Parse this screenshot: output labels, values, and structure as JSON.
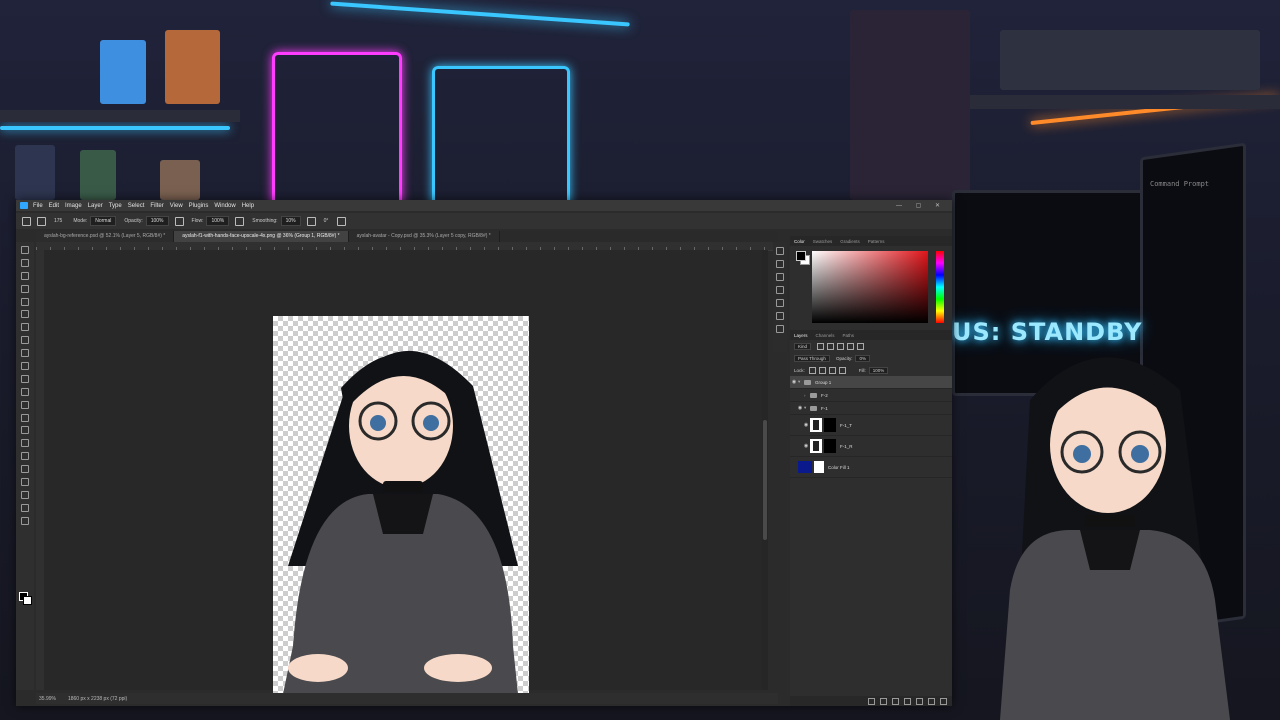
{
  "background": {
    "status_text": "US: STANDBY",
    "terminal_title": "Command Prompt"
  },
  "app": {
    "menu": [
      "File",
      "Edit",
      "Image",
      "Layer",
      "Type",
      "Select",
      "Filter",
      "View",
      "Plugins",
      "Window",
      "Help"
    ],
    "options": {
      "mode_label": "Mode:",
      "mode_value": "Normal",
      "opacity_label": "Opacity:",
      "opacity_value": "100%",
      "flow_label": "Flow:",
      "flow_value": "100%",
      "smoothing_label": "Smoothing:",
      "smoothing_value": "10%",
      "angle_value": "0°",
      "brush_size": "175"
    },
    "tabs": [
      {
        "label": "ayslah-bg-reference.psd @ 52.1% (Layer 5, RGB/8#) *",
        "active": false
      },
      {
        "label": "ayslah-f1-with-hands-face-upscale-4x.png @ 36% (Group 1, RGB/8#) *",
        "active": true
      },
      {
        "label": "ayslah-avatar - Copy.psd @ 35.3% (Layer 5 copy, RGB/8#) *",
        "active": false
      }
    ],
    "status": {
      "zoom": "35.99%",
      "doc_info": "1860 px x 2238 px (72 ppi)"
    }
  },
  "panels": {
    "color_tabs": [
      "Color",
      "Swatches",
      "Gradients",
      "Patterns"
    ],
    "layers_tabs": [
      "Layers",
      "Channels",
      "Paths"
    ],
    "kind": "Kind",
    "blend_mode": "Pass Through",
    "opacity_label": "Opacity:",
    "opacity_value": "0%",
    "lock_label": "Lock:",
    "fill_label": "Fill:",
    "fill_value": "100%",
    "layers": [
      {
        "name": "Group 1",
        "type": "group",
        "visible": true,
        "selected": true,
        "indent": 0
      },
      {
        "name": "F-2",
        "type": "group",
        "visible": false,
        "selected": false,
        "indent": 1
      },
      {
        "name": "F-1",
        "type": "group",
        "visible": true,
        "selected": false,
        "indent": 1
      },
      {
        "name": "F-1_T",
        "type": "layer",
        "visible": true,
        "selected": false,
        "indent": 2
      },
      {
        "name": "F-1_R",
        "type": "layer",
        "visible": true,
        "selected": false,
        "indent": 2
      },
      {
        "name": "Color Fill 1",
        "type": "fill",
        "visible": false,
        "selected": false,
        "indent": 0
      }
    ]
  },
  "colors": {
    "neon_cyan": "#3ac6ff",
    "neon_pink": "#ff3cff",
    "neon_orange": "#ff8a2a",
    "ps_accent": "#31a8ff",
    "fill_blue": "#0a1a8c"
  }
}
